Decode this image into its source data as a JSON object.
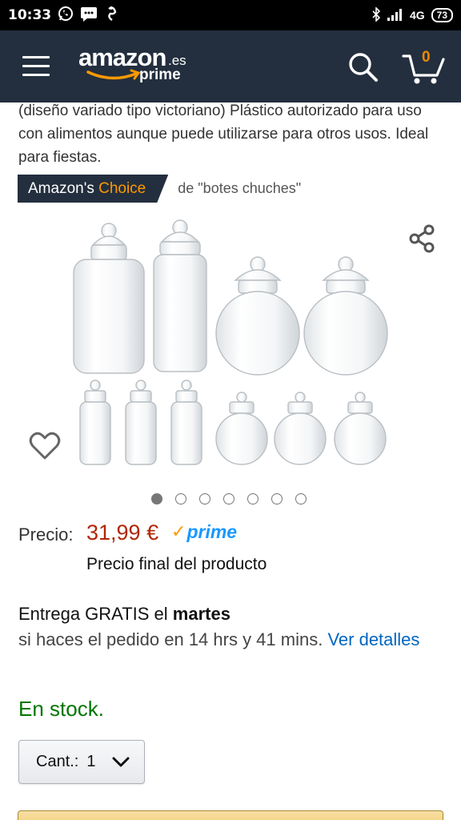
{
  "status_bar": {
    "time": "10:33",
    "network": "4G",
    "battery": "73",
    "icons": [
      "whatsapp-icon",
      "message-icon",
      "notification-icon",
      "bluetooth-icon",
      "signal-icon",
      "battery-icon"
    ]
  },
  "header": {
    "logo_word": "amazon",
    "logo_tld": ".es",
    "logo_sub": "prime",
    "cart_count": "0",
    "colors": {
      "bar": "#232f3e",
      "accent": "#ff9900"
    }
  },
  "product": {
    "description": "(diseño variado tipo victoriano) Plástico autorizado para uso con alimentos aunque puede utilizarse para otros usos. Ideal para fiestas.",
    "badge_prefix": "Amazon's",
    "badge_choice": "Choice",
    "badge_context": "de \"botes chuches\"",
    "image_count": 7,
    "active_image": 0
  },
  "pricing": {
    "label": "Precio:",
    "price": "31,99 €",
    "prime_label": "prime",
    "note": "Precio final del producto",
    "price_color": "#b12704"
  },
  "delivery": {
    "prefix": "Entrega GRATIS el",
    "day": "martes",
    "detail": "si haces el pedido en 14 hrs y 41 mins.",
    "link": "Ver detalles"
  },
  "stock": {
    "status": "En stock.",
    "color": "#007600"
  },
  "quantity": {
    "label": "Cant.:",
    "value": "1"
  }
}
